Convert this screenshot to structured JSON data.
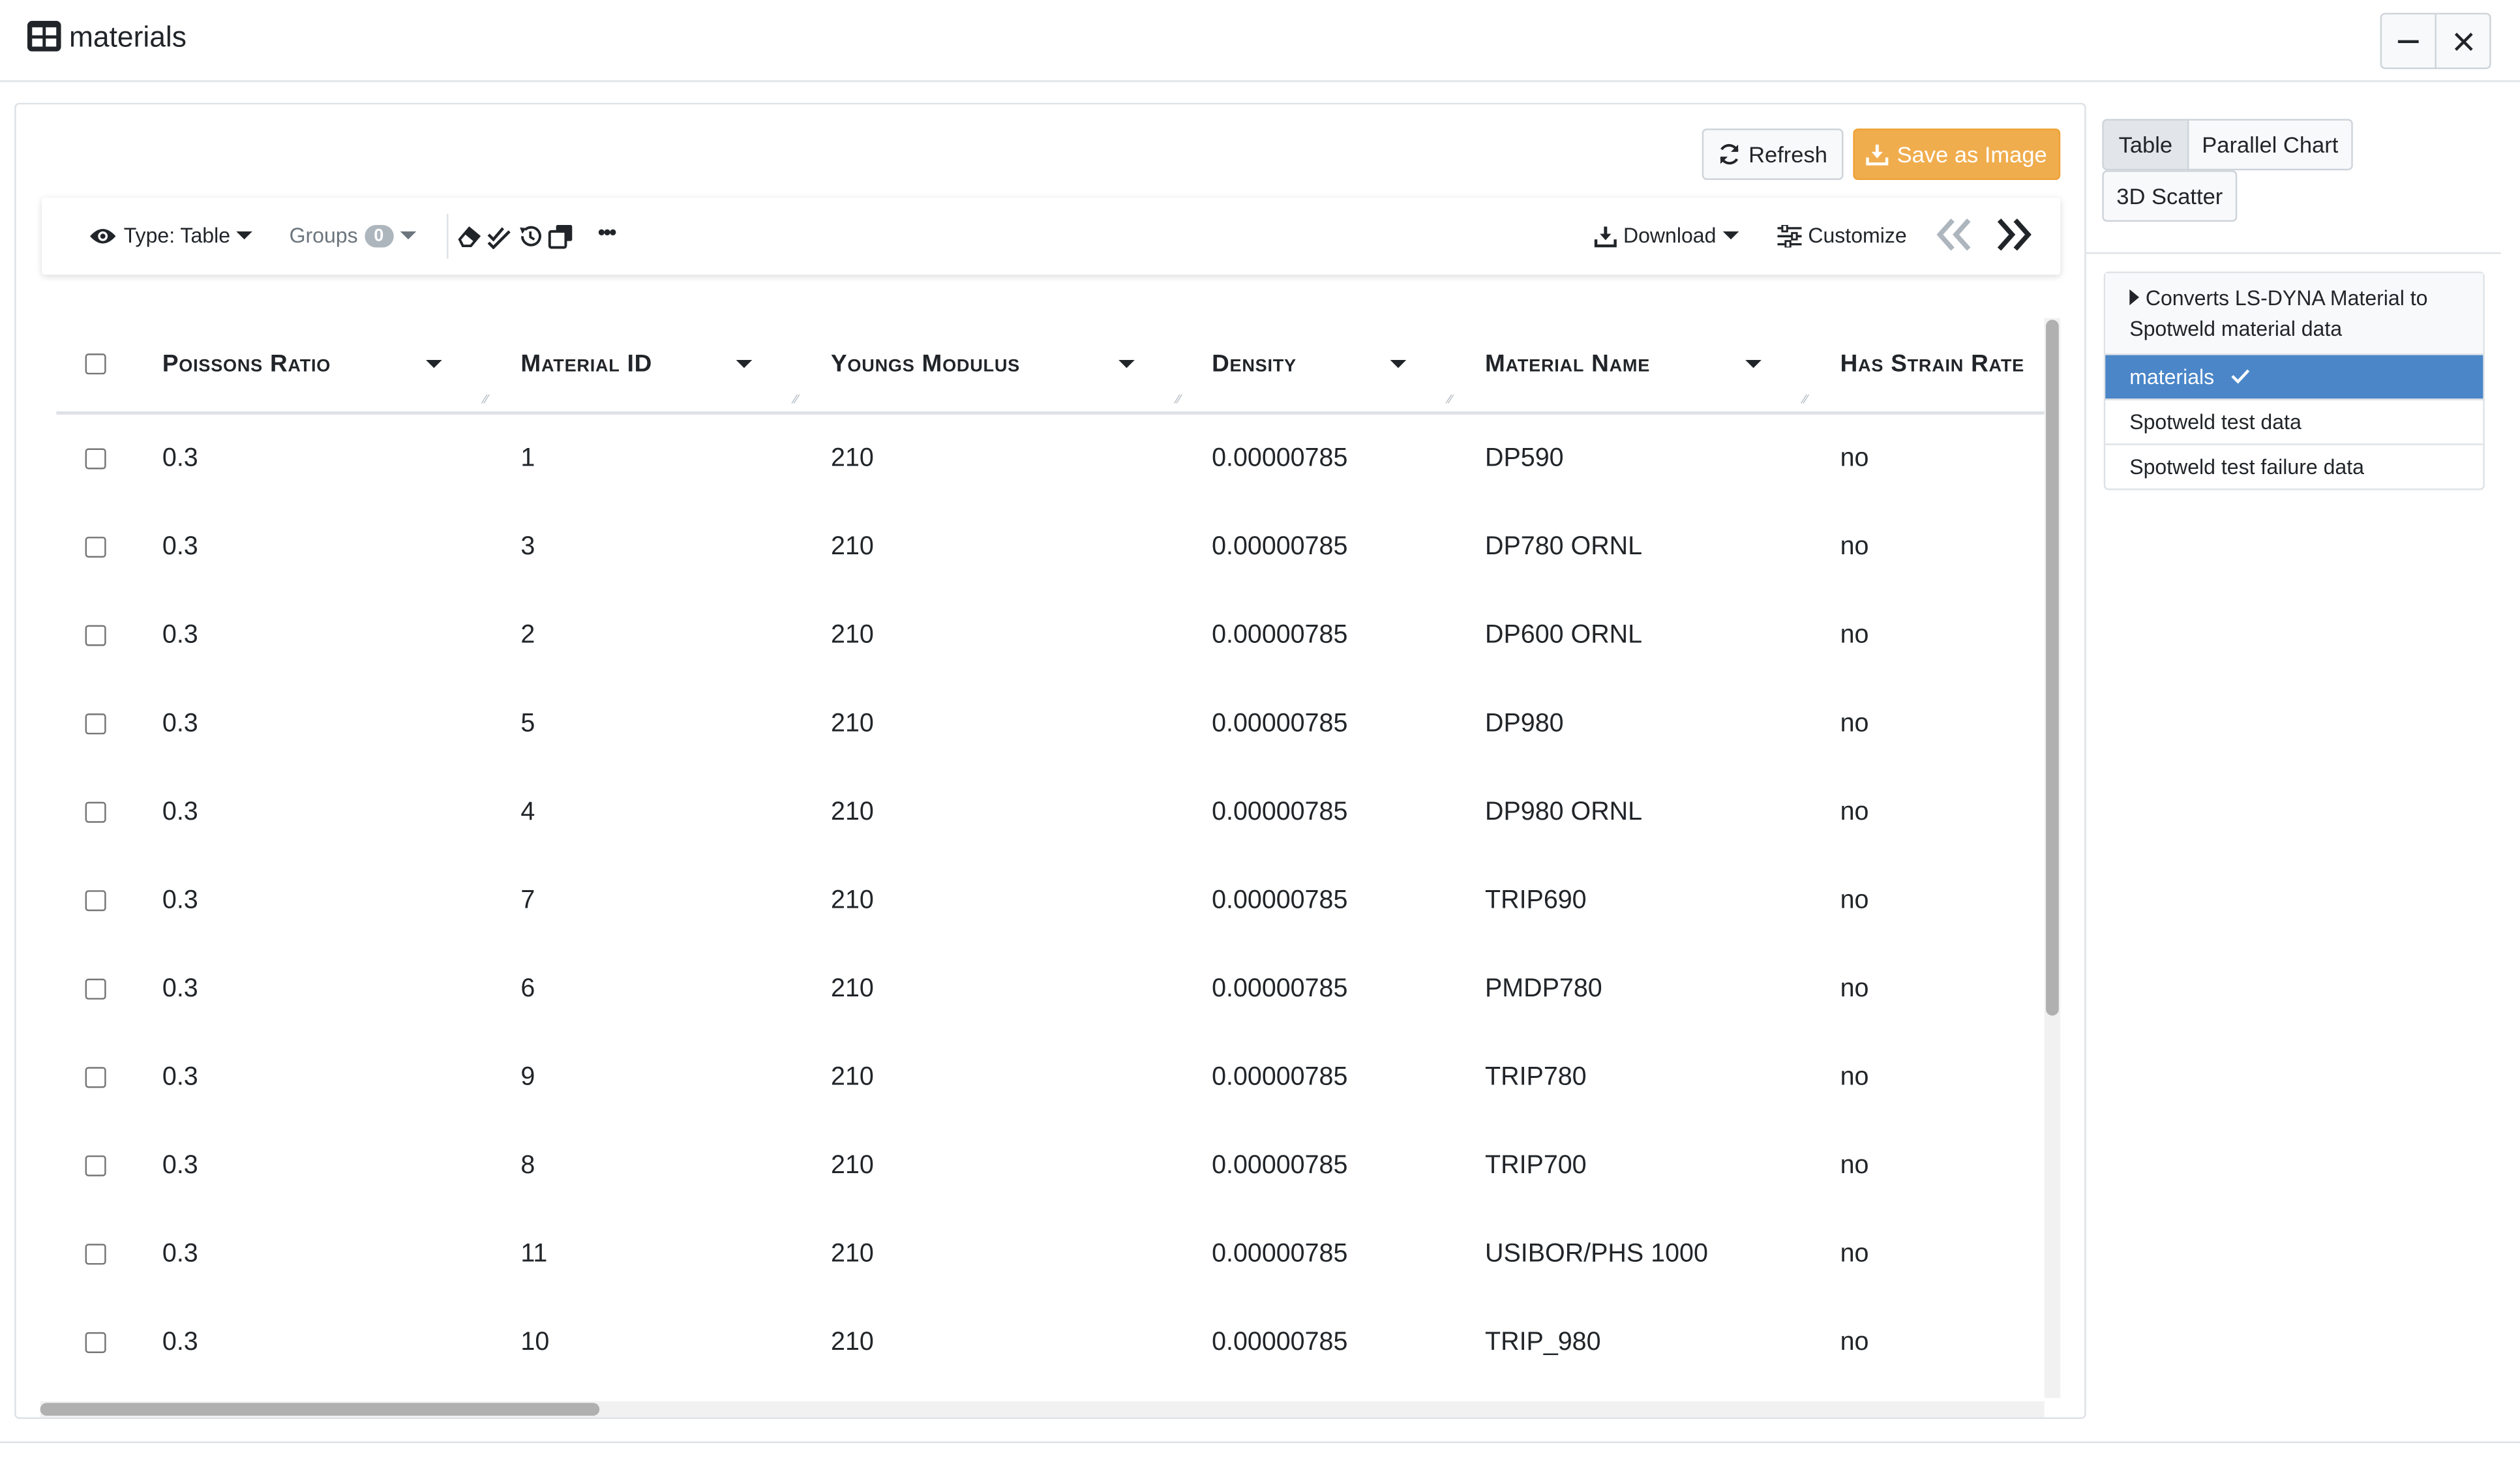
{
  "window": {
    "title": "materials"
  },
  "actions": {
    "refresh": "Refresh",
    "save_image": "Save as Image"
  },
  "toolbar": {
    "type_label": "Type: Table",
    "groups_label": "Groups",
    "groups_count": "0",
    "more": "•••",
    "download": "Download",
    "customize": "Customize"
  },
  "table": {
    "headers": [
      "Poissons Ratio",
      "Material ID",
      "Youngs Modulus",
      "Density",
      "Material Name",
      "Has Strain Rate"
    ],
    "rows": [
      [
        "0.3",
        "1",
        "210",
        "0.00000785",
        "DP590",
        "no"
      ],
      [
        "0.3",
        "3",
        "210",
        "0.00000785",
        "DP780 ORNL",
        "no"
      ],
      [
        "0.3",
        "2",
        "210",
        "0.00000785",
        "DP600 ORNL",
        "no"
      ],
      [
        "0.3",
        "5",
        "210",
        "0.00000785",
        "DP980",
        "no"
      ],
      [
        "0.3",
        "4",
        "210",
        "0.00000785",
        "DP980 ORNL",
        "no"
      ],
      [
        "0.3",
        "7",
        "210",
        "0.00000785",
        "TRIP690",
        "no"
      ],
      [
        "0.3",
        "6",
        "210",
        "0.00000785",
        "PMDP780",
        "no"
      ],
      [
        "0.3",
        "9",
        "210",
        "0.00000785",
        "TRIP780",
        "no"
      ],
      [
        "0.3",
        "8",
        "210",
        "0.00000785",
        "TRIP700",
        "no"
      ],
      [
        "0.3",
        "11",
        "210",
        "0.00000785",
        "USIBOR/PHS 1000",
        "no"
      ],
      [
        "0.3",
        "10",
        "210",
        "0.00000785",
        "TRIP_980",
        "no"
      ]
    ]
  },
  "views": {
    "table": "Table",
    "parallel": "Parallel Chart",
    "scatter": "3D Scatter"
  },
  "datasets": {
    "group_label": "Converts LS-DYNA Material to Spotweld material data",
    "items": [
      {
        "label": "materials",
        "selected": true
      },
      {
        "label": "Spotweld test data",
        "selected": false
      },
      {
        "label": "Spotweld test failure data",
        "selected": false
      }
    ]
  },
  "colors": {
    "accent": "#f0ad4e",
    "selection": "#4a86c8"
  }
}
